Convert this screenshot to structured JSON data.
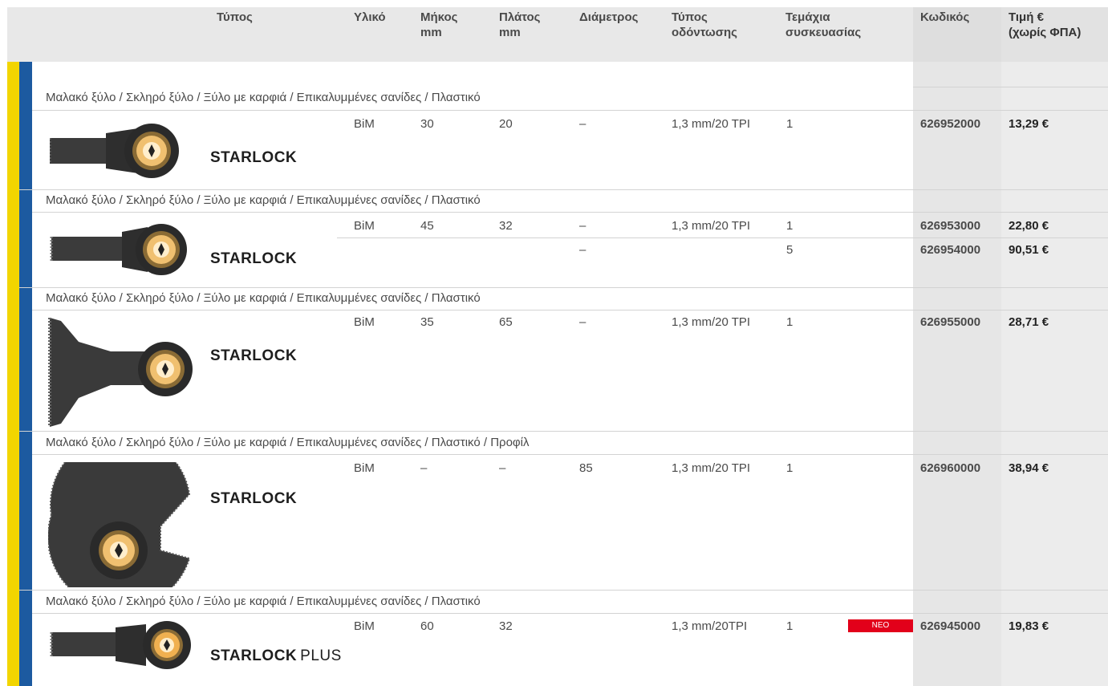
{
  "header": {
    "type": "Τύπος",
    "material": "Υλικό",
    "length": "Μήκος\nmm",
    "width": "Πλάτος\nmm",
    "diameter": "Διάμετρος",
    "tooth_type": "Τύπος\nοδόντωσης",
    "pack_qty": "Τεμάχια\nσυσκευασίας",
    "code": "Κωδικός",
    "price": "Τιμή €\n(χωρίς ΦΠΑ)"
  },
  "products": [
    {
      "category": "Μαλακό ξύλο / Σκληρό ξύλο / Ξύλο με καρφιά / Επικαλυμμένες σανίδες / Πλαστικό",
      "logo": "STARLOCK",
      "tool_icon": "plunge-blade-narrow-icon",
      "rows": [
        {
          "material": "BiM",
          "length": "30",
          "width": "20",
          "diameter": "–",
          "tooth": "1,3 mm/20 TPI",
          "qty": "1",
          "code": "626952000",
          "price": "13,29 €"
        }
      ]
    },
    {
      "category": "Μαλακό ξύλο / Σκληρό ξύλο / Ξύλο με καρφιά / Επικαλυμμένες σανίδες / Πλαστικό",
      "logo": "STARLOCK",
      "tool_icon": "plunge-blade-long-icon",
      "rows": [
        {
          "material": "BiM",
          "length": "45",
          "width": "32",
          "diameter": "–",
          "tooth": "1,3 mm/20 TPI",
          "qty": "1",
          "code": "626953000",
          "price": "22,80 €"
        },
        {
          "material": "",
          "length": "",
          "width": "",
          "diameter": "–",
          "tooth": "",
          "qty": "5",
          "code": "626954000",
          "price": "90,51 €"
        }
      ]
    },
    {
      "category": "Μαλακό ξύλο / Σκληρό ξύλο / Ξύλο με καρφιά / Επικαλυμμένες σανίδες / Πλαστικό",
      "logo": "STARLOCK",
      "tool_icon": "plunge-blade-wide-icon",
      "rows": [
        {
          "material": "BiM",
          "length": "35",
          "width": "65",
          "diameter": "–",
          "tooth": "1,3 mm/20 TPI",
          "qty": "1",
          "code": "626955000",
          "price": "28,71 €"
        }
      ]
    },
    {
      "category": "Μαλακό ξύλο / Σκληρό ξύλο / Ξύλο με καρφιά / Επικαλυμμένες σανίδες / Πλαστικό / Προφίλ",
      "logo": "STARLOCK",
      "tool_icon": "segment-saw-blade-icon",
      "rows": [
        {
          "material": "BiM",
          "length": "–",
          "width": "–",
          "diameter": "85",
          "tooth": "1,3 mm/20 TPI",
          "qty": "1",
          "code": "626960000",
          "price": "38,94 €"
        }
      ]
    },
    {
      "category": "Μαλακό ξύλο / Σκληρό ξύλο / Ξύλο με καρφιά / Επικαλυμμένες σανίδες / Πλαστικό",
      "logo": "STARLOCK",
      "logo_suffix": "PLUS",
      "tool_icon": "plunge-blade-plus-icon",
      "badge": "NEO",
      "rows": [
        {
          "material": "BiM",
          "length": "60",
          "width": "32",
          "diameter": "",
          "tooth": "1,3 mm/20TPI",
          "qty": "1",
          "code": "626945000",
          "price": "19,83 €"
        }
      ]
    }
  ],
  "colors": {
    "yellow_band": "#f2d500",
    "blue_band": "#1c5aa0",
    "new_badge": "#e2001a",
    "header_bg": "#e8e8e8"
  }
}
